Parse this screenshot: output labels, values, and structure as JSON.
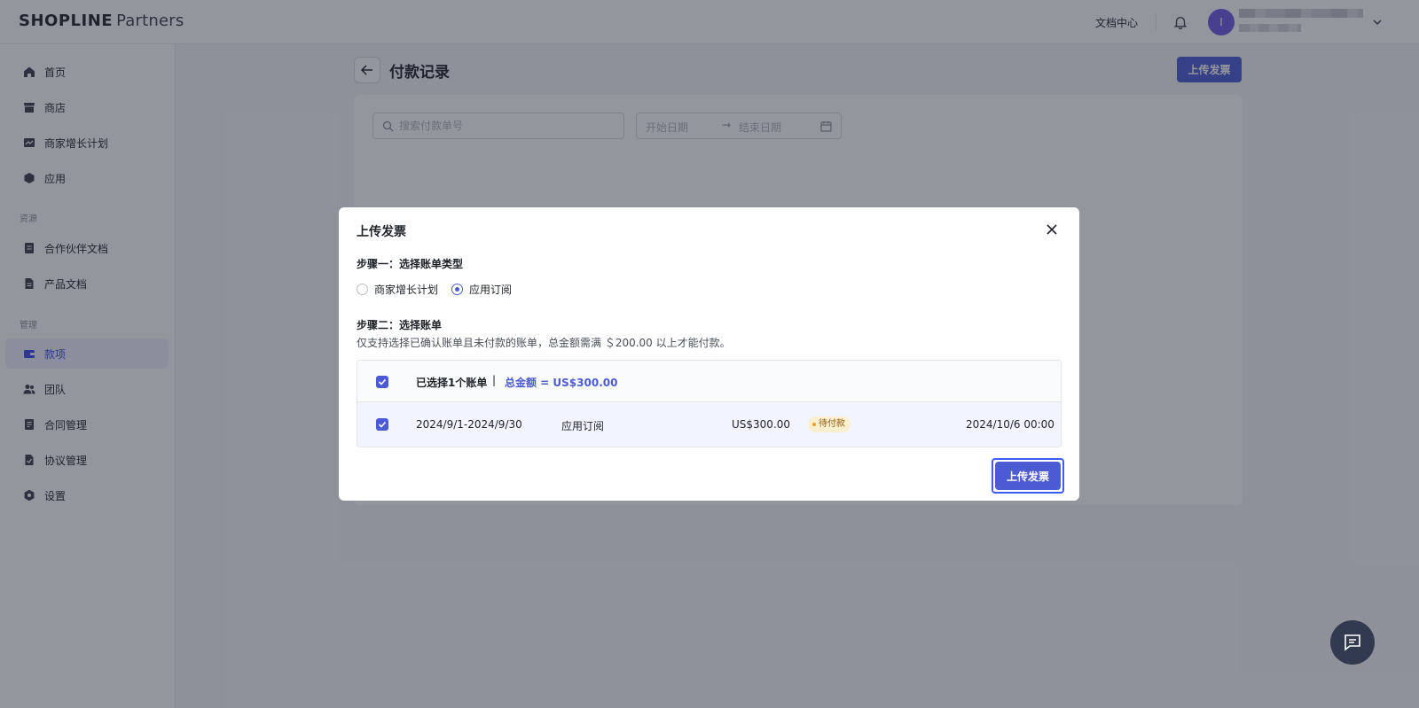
{
  "header": {
    "brand": "SHOPLINE",
    "brand_sub": "Partners",
    "doc_center": "文档中心",
    "avatar_initial": "I"
  },
  "sidebar": {
    "items_top": [
      {
        "label": "首页",
        "icon": "home-icon"
      },
      {
        "label": "商店",
        "icon": "store-icon"
      },
      {
        "label": "商家增长计划",
        "icon": "growth-plan-icon"
      },
      {
        "label": "应用",
        "icon": "app-icon"
      }
    ],
    "section_resources": "资源",
    "items_resources": [
      {
        "label": "合作伙伴文档",
        "icon": "partner-docs-icon"
      },
      {
        "label": "产品文档",
        "icon": "product-docs-icon"
      }
    ],
    "section_manage": "管理",
    "items_manage": [
      {
        "label": "款项",
        "icon": "payments-icon",
        "active": true
      },
      {
        "label": "团队",
        "icon": "team-icon"
      },
      {
        "label": "合同管理",
        "icon": "contract-icon"
      },
      {
        "label": "协议管理",
        "icon": "agreement-icon"
      },
      {
        "label": "设置",
        "icon": "settings-icon"
      }
    ]
  },
  "page": {
    "title": "付款记录",
    "upload_button": "上传发票",
    "search_placeholder": "搜索付款单号",
    "date_start_placeholder": "开始日期",
    "date_arrow": "→",
    "date_end_placeholder": "结束日期"
  },
  "modal": {
    "title": "上传发票",
    "step1_label": "步骤一：选择账单类型",
    "radio_options": [
      {
        "label": "商家增长计划",
        "checked": false
      },
      {
        "label": "应用订阅",
        "checked": true
      }
    ],
    "step2_label": "步骤二：选择账单",
    "note": "仅支持选择已确认账单且未付款的账单，总金额需满 ＄200.00 以上才能付款。",
    "table": {
      "header_selected": "已选择1个账单",
      "header_sep": "|",
      "header_total": "总金额 = US$300.00",
      "rows": [
        {
          "checked": true,
          "period": "2024/9/1-2024/9/30",
          "type": "应用订阅",
          "amount": "US$300.00",
          "status": "待付款",
          "date": "2024/10/6 00:00"
        }
      ]
    },
    "upload_button": "上传发票"
  },
  "colors": {
    "accent": "#4c5bd4",
    "badge_bg": "#fdefd0",
    "overlay": "rgba(31,36,52,0.48)"
  }
}
